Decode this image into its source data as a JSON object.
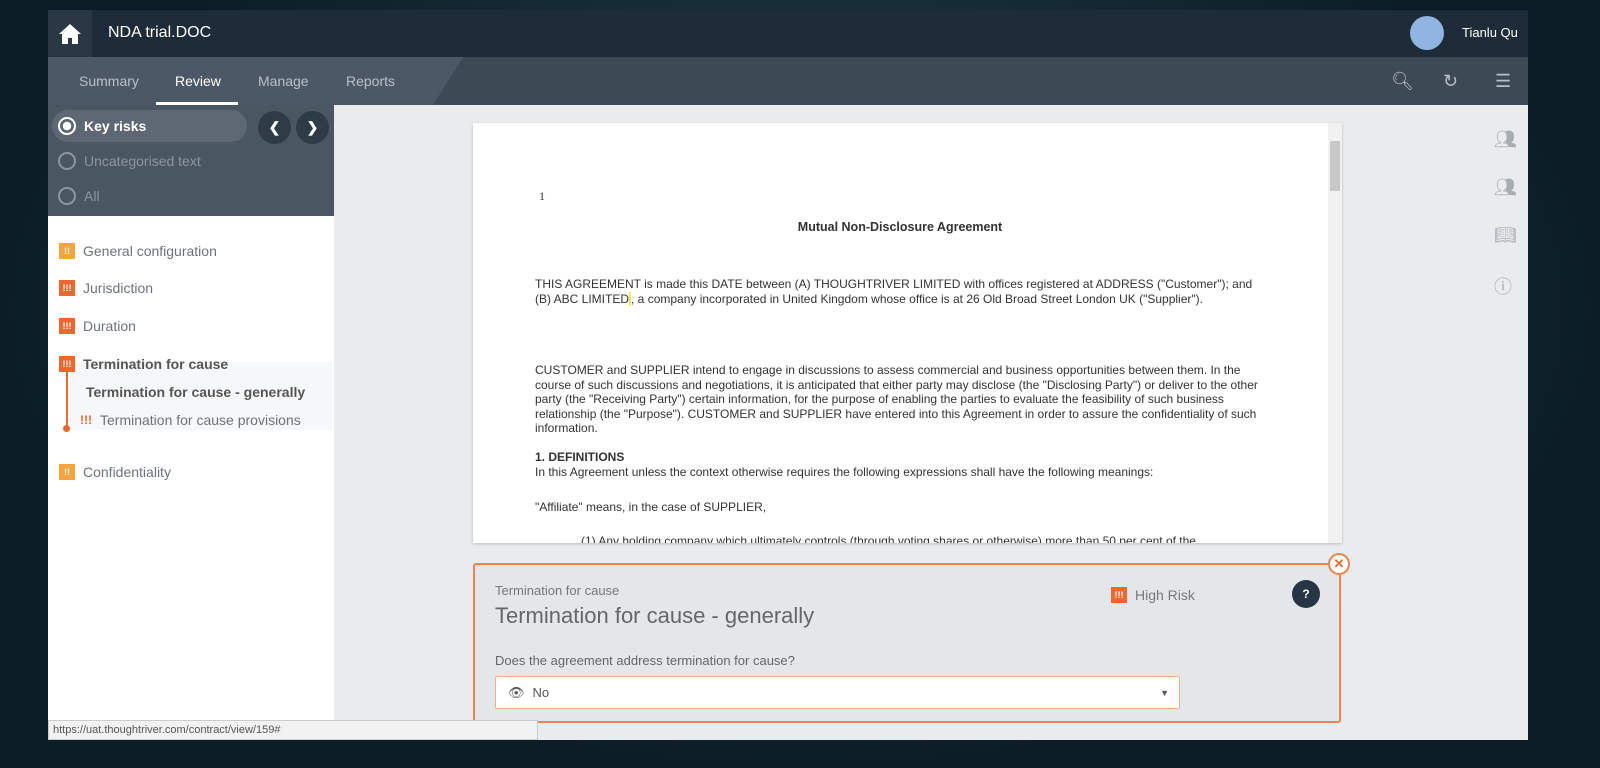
{
  "header": {
    "title": "NDA trial.DOC",
    "user": "Tianlu Qu"
  },
  "tabs": [
    {
      "label": "Summary"
    },
    {
      "label": "Review",
      "active": true
    },
    {
      "label": "Manage"
    },
    {
      "label": "Reports"
    }
  ],
  "filters": [
    {
      "label": "Key risks",
      "selected": true
    },
    {
      "label": "Uncategorised text"
    },
    {
      "label": "All"
    }
  ],
  "risk_items": [
    {
      "label": "General configuration",
      "risk": "medium",
      "badge": "!!"
    },
    {
      "label": "Jurisdiction",
      "risk": "high",
      "badge": "!!!"
    },
    {
      "label": "Duration",
      "risk": "high",
      "badge": "!!!"
    },
    {
      "label": "Termination for cause",
      "risk": "high",
      "badge": "!!!"
    },
    {
      "label": "Confidentiality",
      "risk": "medium",
      "badge": "!!"
    }
  ],
  "sub_items": {
    "group": "Termination for cause - generally",
    "child": "Termination for cause provisions",
    "child_badge": "!!!"
  },
  "document": {
    "page_number": "1",
    "heading": "Mutual Non-Disclosure Agreement",
    "p1a": "THIS AGREEMENT is made this DATE between (A) THOUGHTRIVER LIMITED with offices registered at ADDRESS (\"Customer\"); and (B) ABC LIMITED",
    "p1b": ", a company incorporated in United Kingdom whose office is at 26 Old Broad Street London UK (\"Supplier\").",
    "p2": "CUSTOMER and SUPPLIER intend to engage in discussions to assess commercial and business opportunities between them. In the course of such discussions and negotiations, it is anticipated that either party may disclose (the \"Disclosing Party\") or deliver to the other party (the \"Receiving Party\") certain information, for the purpose of enabling the parties to evaluate the feasibility of such business relationship (the \"Purpose\"). CUSTOMER and SUPPLIER have entered into this Agreement in order to assure the confidentiality of such information.",
    "s1": "1. DEFINITIONS",
    "s1text": "In this Agreement unless the context otherwise requires the following expressions shall have the following meanings:",
    "p3": "\"Affiliate\" means, in the case of SUPPLIER,",
    "p4": "(1) Any holding company which ultimately controls (through voting shares or otherwise) more than 50 per cent of the"
  },
  "panel": {
    "category": "Termination for cause",
    "title": "Termination for cause - generally",
    "risk_badge": "!!!",
    "risk_label": "High Risk",
    "question": "Does the agreement address termination for cause?",
    "answer": "No",
    "help": "?"
  },
  "status_url": "https://uat.thoughtriver.com/contract/view/159#",
  "colors": {
    "high": "#f0662c",
    "medium": "#f5a53a",
    "topbar": "#1e2b38"
  }
}
